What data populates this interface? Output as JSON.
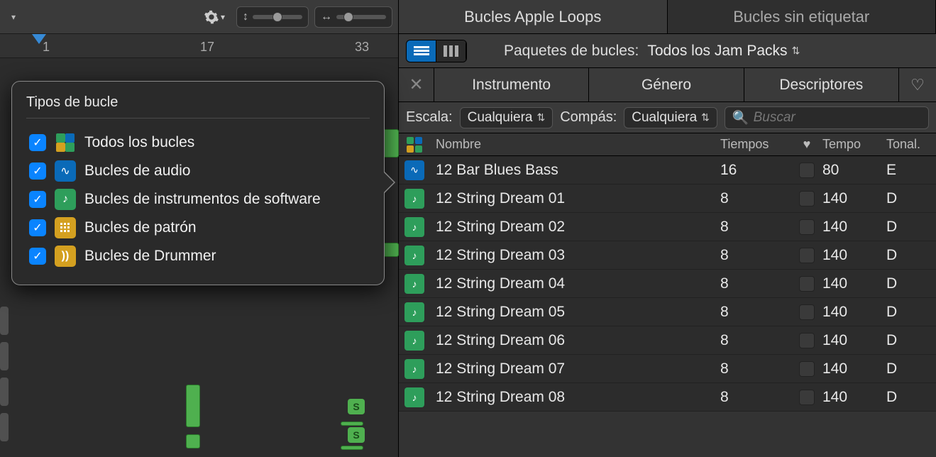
{
  "left": {
    "ruler": {
      "marks": [
        "1",
        "17",
        "33"
      ]
    }
  },
  "popover": {
    "title": "Tipos de bucle",
    "items": [
      {
        "label": "Todos los bucles",
        "type": "all"
      },
      {
        "label": "Bucles de audio",
        "type": "audio"
      },
      {
        "label": "Bucles de instrumentos de software",
        "type": "software"
      },
      {
        "label": "Bucles de patrón",
        "type": "pattern"
      },
      {
        "label": "Bucles de Drummer",
        "type": "drummer"
      }
    ]
  },
  "tabs": {
    "apple": "Bucles Apple Loops",
    "untagged": "Bucles sin etiquetar"
  },
  "packs": {
    "label": "Paquetes de bucles:",
    "value": "Todos los Jam Packs"
  },
  "filters": {
    "instrument": "Instrumento",
    "genre": "Género",
    "descriptors": "Descriptores"
  },
  "scale": {
    "label": "Escala:",
    "value": "Cualquiera",
    "compas_label": "Compás:",
    "compas_value": "Cualquiera"
  },
  "search": {
    "placeholder": "Buscar"
  },
  "columns": {
    "name": "Nombre",
    "beats": "Tiempos",
    "tempo": "Tempo",
    "key": "Tonal."
  },
  "loops": [
    {
      "type": "audio",
      "name": "12 Bar Blues Bass",
      "beats": "16",
      "tempo": "80",
      "key": "E"
    },
    {
      "type": "software",
      "name": "12 String Dream 01",
      "beats": "8",
      "tempo": "140",
      "key": "D"
    },
    {
      "type": "software",
      "name": "12 String Dream 02",
      "beats": "8",
      "tempo": "140",
      "key": "D"
    },
    {
      "type": "software",
      "name": "12 String Dream 03",
      "beats": "8",
      "tempo": "140",
      "key": "D"
    },
    {
      "type": "software",
      "name": "12 String Dream 04",
      "beats": "8",
      "tempo": "140",
      "key": "D"
    },
    {
      "type": "software",
      "name": "12 String Dream 05",
      "beats": "8",
      "tempo": "140",
      "key": "D"
    },
    {
      "type": "software",
      "name": "12 String Dream 06",
      "beats": "8",
      "tempo": "140",
      "key": "D"
    },
    {
      "type": "software",
      "name": "12 String Dream 07",
      "beats": "8",
      "tempo": "140",
      "key": "D"
    },
    {
      "type": "software",
      "name": "12 String Dream 08",
      "beats": "8",
      "tempo": "140",
      "key": "D"
    }
  ]
}
